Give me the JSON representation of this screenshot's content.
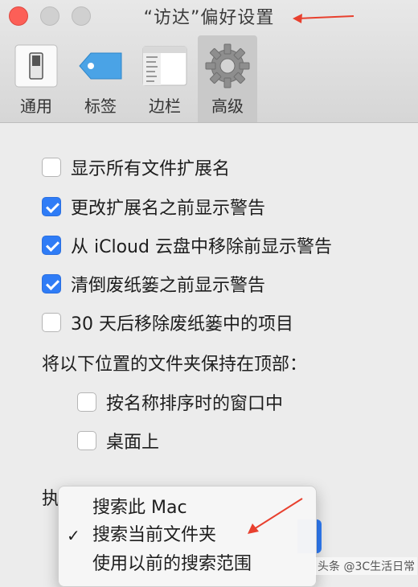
{
  "window": {
    "title": "“访达”偏好设置"
  },
  "tabs": [
    {
      "label": "通用",
      "icon": "switch-icon",
      "selected": false
    },
    {
      "label": "标签",
      "icon": "tag-icon",
      "selected": false
    },
    {
      "label": "边栏",
      "icon": "sidebar-icon",
      "selected": false
    },
    {
      "label": "高级",
      "icon": "gear-icon",
      "selected": true
    }
  ],
  "options": [
    {
      "label": "显示所有文件扩展名",
      "checked": false
    },
    {
      "label": "更改扩展名之前显示警告",
      "checked": true
    },
    {
      "label": "从 iCloud 云盘中移除前显示警告",
      "checked": true
    },
    {
      "label": "清倒废纸篓之前显示警告",
      "checked": true
    },
    {
      "label": "30 天后移除废纸篓中的项目",
      "checked": false
    }
  ],
  "folders_on_top": {
    "label": "将以下位置的文件夹保持在顶部：",
    "items": [
      {
        "label": "按名称排序时的窗口中",
        "checked": false
      },
      {
        "label": "桌面上",
        "checked": false
      }
    ]
  },
  "search": {
    "label_visible": "执",
    "menu": [
      {
        "label": "搜索此 Mac",
        "checked": false
      },
      {
        "label": "搜索当前文件夹",
        "checked": true
      },
      {
        "label": "使用以前的搜索范围",
        "checked": false
      }
    ]
  },
  "watermark": "头条 @3C生活日常",
  "colors": {
    "accent": "#2f7cf6",
    "close": "#fc5f57",
    "annotation": "#e8402e"
  }
}
